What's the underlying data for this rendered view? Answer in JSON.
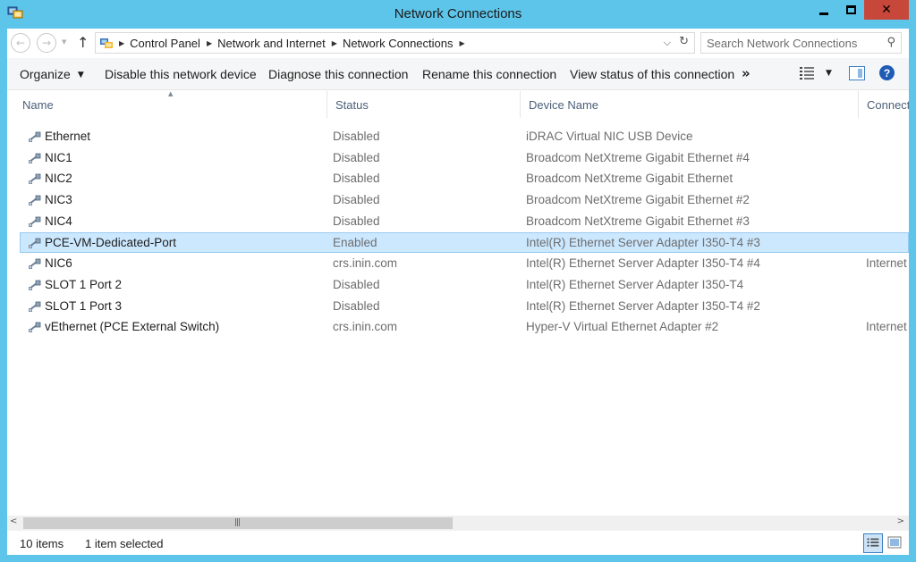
{
  "window": {
    "title": "Network Connections",
    "close_glyph": "✕"
  },
  "nav": {
    "back_glyph": "←",
    "forward_glyph": "→",
    "up_glyph": "↑",
    "breadcrumb": [
      "Control Panel",
      "Network and Internet",
      "Network Connections"
    ],
    "search_placeholder": "Search Network Connections"
  },
  "toolbar": {
    "organize": "Organize",
    "disable": "Disable this network device",
    "diagnose": "Diagnose this connection",
    "rename": "Rename this connection",
    "view_status": "View status of this connection",
    "more": "»"
  },
  "columns": {
    "name": "Name",
    "status": "Status",
    "device": "Device Name",
    "connectivity": "Connect"
  },
  "rows": [
    {
      "name": "Ethernet",
      "status": "Disabled",
      "device": "iDRAC Virtual NIC USB Device",
      "connectivity": ""
    },
    {
      "name": "NIC1",
      "status": "Disabled",
      "device": "Broadcom NetXtreme Gigabit Ethernet #4",
      "connectivity": ""
    },
    {
      "name": "NIC2",
      "status": "Disabled",
      "device": "Broadcom NetXtreme Gigabit Ethernet",
      "connectivity": ""
    },
    {
      "name": "NIC3",
      "status": "Disabled",
      "device": "Broadcom NetXtreme Gigabit Ethernet #2",
      "connectivity": ""
    },
    {
      "name": "NIC4",
      "status": "Disabled",
      "device": "Broadcom NetXtreme Gigabit Ethernet #3",
      "connectivity": ""
    },
    {
      "name": "PCE-VM-Dedicated-Port",
      "status": "Enabled",
      "device": "Intel(R) Ethernet Server Adapter I350-T4 #3",
      "connectivity": "",
      "selected": true
    },
    {
      "name": "NIC6",
      "status": "crs.inin.com",
      "device": "Intel(R) Ethernet Server Adapter I350-T4 #4",
      "connectivity": "Internet"
    },
    {
      "name": "SLOT 1 Port 2",
      "status": "Disabled",
      "device": "Intel(R) Ethernet Server Adapter I350-T4",
      "connectivity": ""
    },
    {
      "name": "SLOT 1 Port 3",
      "status": "Disabled",
      "device": "Intel(R) Ethernet Server Adapter I350-T4 #2",
      "connectivity": ""
    },
    {
      "name": "vEthernet (PCE External Switch)",
      "status": "crs.inin.com",
      "device": "Hyper-V Virtual Ethernet Adapter #2",
      "connectivity": "Internet"
    }
  ],
  "statusbar": {
    "item_count": "10 items",
    "selection": "1 item selected"
  },
  "colors": {
    "frame": "#5ec5ea",
    "close_button": "#c7483b",
    "selection": "#cce8ff",
    "selection_border": "#99c9ef",
    "header_text": "#4c607a"
  },
  "icons": {
    "app": "network-connections-icon",
    "row": "network-adapter-icon",
    "search": "search-icon",
    "help": "help-icon"
  }
}
